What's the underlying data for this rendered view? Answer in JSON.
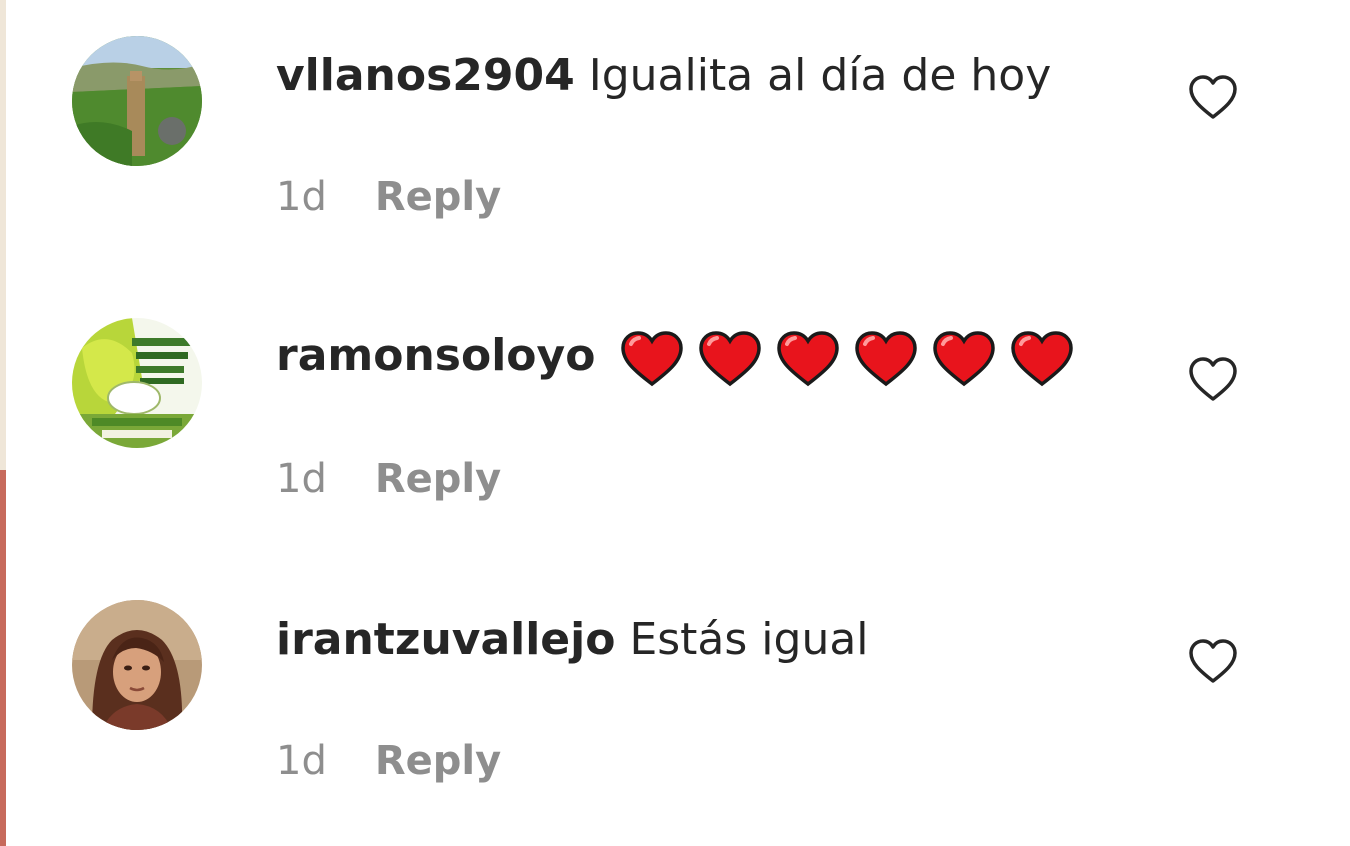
{
  "comments": [
    {
      "username": "vllanos2904",
      "text": "Igualita al día de hoy",
      "time": "1d",
      "reply_label": "Reply",
      "avatar": "landscape-photo"
    },
    {
      "username": "ramonsoloyo",
      "text": "",
      "emoji": [
        "❤️",
        "❤️",
        "❤️",
        "❤️",
        "❤️",
        "❤️"
      ],
      "time": "1d",
      "reply_label": "Reply",
      "avatar": "green-graphic-logo"
    },
    {
      "username": "irantzuvallejo",
      "text": "Estás igual",
      "time": "1d",
      "reply_label": "Reply",
      "avatar": "woman-portrait"
    }
  ],
  "icons": {
    "like": "heart-outline-icon",
    "emoji": "red-heart-emoji"
  },
  "colors": {
    "text": "#262626",
    "secondary": "#8e8e8e",
    "heart_emoji": "#e8141c"
  }
}
